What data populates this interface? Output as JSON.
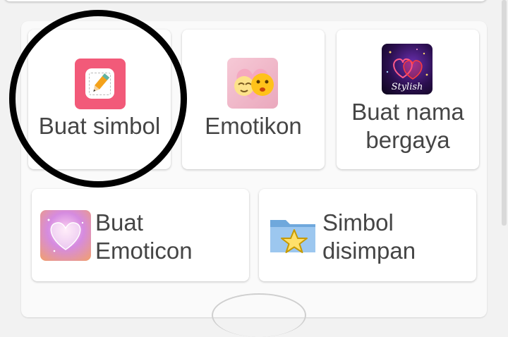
{
  "menu": {
    "items": [
      {
        "label": "Buat simbol",
        "icon": "pencil-note-icon"
      },
      {
        "label": "Emotikon",
        "icon": "emoji-faces-icon"
      },
      {
        "label_line1": "Buat nama",
        "label_line2": "bergaya",
        "icon": "stylish-hearts-icon",
        "icon_text": "Stylish"
      },
      {
        "label_line1": "Buat",
        "label_line2": "Emoticon",
        "icon": "heart-glow-icon"
      },
      {
        "label_line1": "Simbol",
        "label_line2": "disimpan",
        "icon": "folder-star-icon"
      }
    ]
  },
  "colors": {
    "tile_bg": "#ffffff",
    "page_bg": "#f2f2f2",
    "label_text": "#454545",
    "pencil_icon_bg": "#f25a79",
    "highlight_ring": "#000000"
  }
}
